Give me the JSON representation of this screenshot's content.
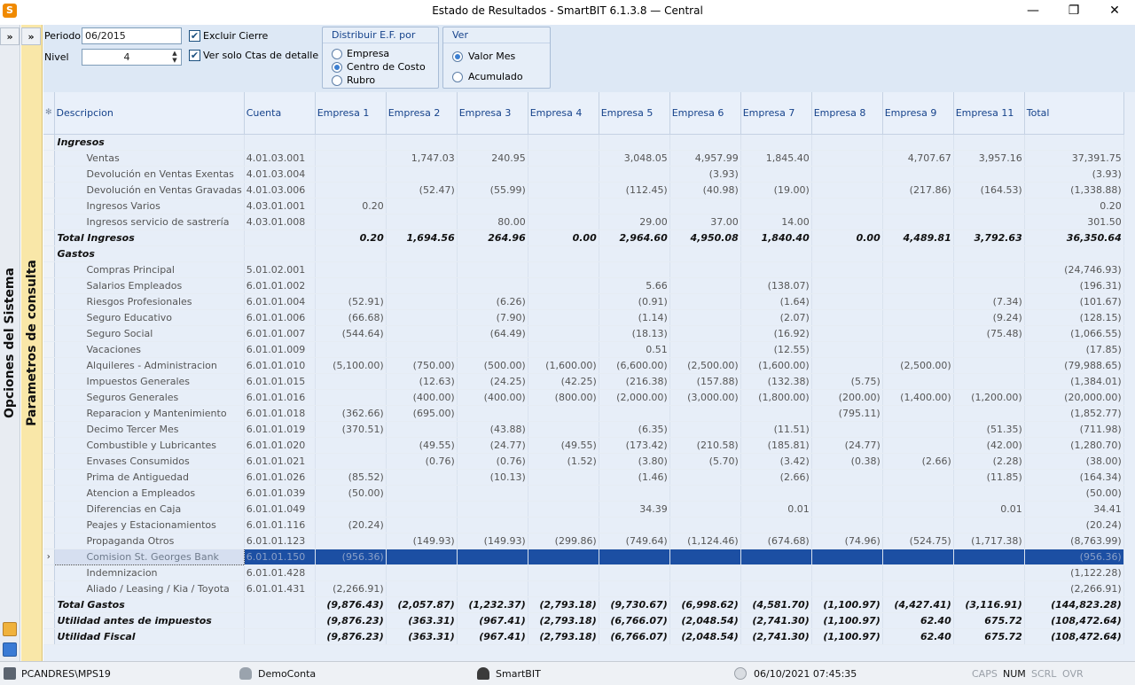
{
  "window": {
    "app_icon": "S",
    "title": "Estado de Resultados - SmartBIT 6.1.3.8 — Central",
    "minimize": "—",
    "restore": "❐",
    "close": "✕"
  },
  "sidebar": {
    "expand_outer": "»",
    "expand_inner": "»",
    "outer_label": "Opciones del Sistema",
    "inner_label": "Parametros de consulta"
  },
  "params": {
    "periodo_label": "Periodo",
    "periodo_value": "06/2015",
    "nivel_label": "Nivel",
    "nivel_value": "4",
    "excluir_cierre_label": "Excluir Cierre",
    "excluir_cierre_checked": "✔",
    "ver_solo_label": "Ver solo Ctas de detalle",
    "ver_solo_checked": "✔",
    "distribuir": {
      "title": "Distribuir E.F. por",
      "options": [
        "Empresa",
        "Centro de Costo",
        "Rubro"
      ]
    },
    "ver": {
      "title": "Ver",
      "options": [
        "Valor Mes",
        "Acumulado"
      ]
    }
  },
  "grid": {
    "indicator_header": "✻",
    "columns": [
      "Descripcion",
      "Cuenta",
      "Empresa 1",
      "Empresa 2",
      "Empresa 3",
      "Empresa 4",
      "Empresa 5",
      "Empresa 6",
      "Empresa 7",
      "Empresa 8",
      "Empresa 9",
      "Empresa 11",
      "Total"
    ],
    "selected_marker": "›",
    "rows": [
      {
        "type": "section",
        "cells": [
          "Ingresos",
          "",
          "",
          "",
          "",
          "",
          "",
          "",
          "",
          "",
          "",
          "",
          ""
        ]
      },
      {
        "type": "detail",
        "cells": [
          "Ventas",
          "4.01.03.001",
          "",
          "1,747.03",
          "240.95",
          "",
          "3,048.05",
          "4,957.99",
          "1,845.40",
          "",
          "4,707.67",
          "3,957.16",
          "37,391.75"
        ]
      },
      {
        "type": "detail",
        "cells": [
          "Devolución en Ventas Exentas",
          "4.01.03.004",
          "",
          "",
          "",
          "",
          "",
          "(3.93)",
          "",
          "",
          "",
          "",
          "(3.93)"
        ]
      },
      {
        "type": "detail",
        "cells": [
          "Devolución en  Ventas Gravadas",
          "4.01.03.006",
          "",
          "(52.47)",
          "(55.99)",
          "",
          "(112.45)",
          "(40.98)",
          "(19.00)",
          "",
          "(217.86)",
          "(164.53)",
          "(1,338.88)"
        ]
      },
      {
        "type": "detail",
        "cells": [
          "Ingresos Varios",
          "4.03.01.001",
          "0.20",
          "",
          "",
          "",
          "",
          "",
          "",
          "",
          "",
          "",
          "0.20"
        ]
      },
      {
        "type": "detail",
        "cells": [
          "Ingresos servicio de sastrería",
          "4.03.01.008",
          "",
          "",
          "80.00",
          "",
          "29.00",
          "37.00",
          "14.00",
          "",
          "",
          "",
          "301.50"
        ]
      },
      {
        "type": "total",
        "cells": [
          "Total Ingresos",
          "",
          "0.20",
          "1,694.56",
          "264.96",
          "0.00",
          "2,964.60",
          "4,950.08",
          "1,840.40",
          "0.00",
          "4,489.81",
          "3,792.63",
          "36,350.64"
        ]
      },
      {
        "type": "section",
        "cells": [
          "Gastos",
          "",
          "",
          "",
          "",
          "",
          "",
          "",
          "",
          "",
          "",
          "",
          ""
        ]
      },
      {
        "type": "detail",
        "cells": [
          "Compras Principal",
          "5.01.02.001",
          "",
          "",
          "",
          "",
          "",
          "",
          "",
          "",
          "",
          "",
          "(24,746.93)"
        ]
      },
      {
        "type": "detail",
        "cells": [
          "Salarios Empleados",
          "6.01.01.002",
          "",
          "",
          "",
          "",
          "5.66",
          "",
          "(138.07)",
          "",
          "",
          "",
          "(196.31)"
        ]
      },
      {
        "type": "detail",
        "cells": [
          "Riesgos Profesionales",
          "6.01.01.004",
          "(52.91)",
          "",
          "(6.26)",
          "",
          "(0.91)",
          "",
          "(1.64)",
          "",
          "",
          "(7.34)",
          "(101.67)"
        ]
      },
      {
        "type": "detail",
        "cells": [
          "Seguro Educativo",
          "6.01.01.006",
          "(66.68)",
          "",
          "(7.90)",
          "",
          "(1.14)",
          "",
          "(2.07)",
          "",
          "",
          "(9.24)",
          "(128.15)"
        ]
      },
      {
        "type": "detail",
        "cells": [
          "Seguro Social",
          "6.01.01.007",
          "(544.64)",
          "",
          "(64.49)",
          "",
          "(18.13)",
          "",
          "(16.92)",
          "",
          "",
          "(75.48)",
          "(1,066.55)"
        ]
      },
      {
        "type": "detail",
        "cells": [
          "Vacaciones",
          "6.01.01.009",
          "",
          "",
          "",
          "",
          "0.51",
          "",
          "(12.55)",
          "",
          "",
          "",
          "(17.85)"
        ]
      },
      {
        "type": "detail",
        "cells": [
          "Alquileres - Administracion",
          "6.01.01.010",
          "(5,100.00)",
          "(750.00)",
          "(500.00)",
          "(1,600.00)",
          "(6,600.00)",
          "(2,500.00)",
          "(1,600.00)",
          "",
          "(2,500.00)",
          "",
          "(79,988.65)"
        ]
      },
      {
        "type": "detail",
        "cells": [
          "Impuestos Generales",
          "6.01.01.015",
          "",
          "(12.63)",
          "(24.25)",
          "(42.25)",
          "(216.38)",
          "(157.88)",
          "(132.38)",
          "(5.75)",
          "",
          "",
          "(1,384.01)"
        ]
      },
      {
        "type": "detail",
        "cells": [
          "Seguros Generales",
          "6.01.01.016",
          "",
          "(400.00)",
          "(400.00)",
          "(800.00)",
          "(2,000.00)",
          "(3,000.00)",
          "(1,800.00)",
          "(200.00)",
          "(1,400.00)",
          "(1,200.00)",
          "(20,000.00)"
        ]
      },
      {
        "type": "detail",
        "cells": [
          "Reparacion y Mantenimiento",
          "6.01.01.018",
          "(362.66)",
          "(695.00)",
          "",
          "",
          "",
          "",
          "",
          "(795.11)",
          "",
          "",
          "(1,852.77)"
        ]
      },
      {
        "type": "detail",
        "cells": [
          "Decimo Tercer Mes",
          "6.01.01.019",
          "(370.51)",
          "",
          "(43.88)",
          "",
          "(6.35)",
          "",
          "(11.51)",
          "",
          "",
          "(51.35)",
          "(711.98)"
        ]
      },
      {
        "type": "detail",
        "cells": [
          "Combustible y Lubricantes",
          "6.01.01.020",
          "",
          "(49.55)",
          "(24.77)",
          "(49.55)",
          "(173.42)",
          "(210.58)",
          "(185.81)",
          "(24.77)",
          "",
          "(42.00)",
          "(1,280.70)"
        ]
      },
      {
        "type": "detail",
        "cells": [
          "Envases Consumidos",
          "6.01.01.021",
          "",
          "(0.76)",
          "(0.76)",
          "(1.52)",
          "(3.80)",
          "(5.70)",
          "(3.42)",
          "(0.38)",
          "(2.66)",
          "(2.28)",
          "(38.00)"
        ]
      },
      {
        "type": "detail",
        "cells": [
          "Prima de Antiguedad",
          "6.01.01.026",
          "(85.52)",
          "",
          "(10.13)",
          "",
          "(1.46)",
          "",
          "(2.66)",
          "",
          "",
          "(11.85)",
          "(164.34)"
        ]
      },
      {
        "type": "detail",
        "cells": [
          "Atencion a Empleados",
          "6.01.01.039",
          "(50.00)",
          "",
          "",
          "",
          "",
          "",
          "",
          "",
          "",
          "",
          "(50.00)"
        ]
      },
      {
        "type": "detail",
        "cells": [
          "Diferencias en Caja",
          "6.01.01.049",
          "",
          "",
          "",
          "",
          "34.39",
          "",
          "0.01",
          "",
          "",
          "0.01",
          "34.41"
        ]
      },
      {
        "type": "detail",
        "cells": [
          "Peajes y Estacionamientos",
          "6.01.01.116",
          "(20.24)",
          "",
          "",
          "",
          "",
          "",
          "",
          "",
          "",
          "",
          "(20.24)"
        ]
      },
      {
        "type": "detail",
        "cells": [
          "Propaganda Otros",
          "6.01.01.123",
          "",
          "(149.93)",
          "(149.93)",
          "(299.86)",
          "(749.64)",
          "(1,124.46)",
          "(674.68)",
          "(74.96)",
          "(524.75)",
          "(1,717.38)",
          "(8,763.99)"
        ]
      },
      {
        "type": "selected",
        "cells": [
          "Comision St. Georges Bank",
          "6.01.01.150",
          "(956.36)",
          "",
          "",
          "",
          "",
          "",
          "",
          "",
          "",
          "",
          "(956.36)"
        ]
      },
      {
        "type": "detail",
        "cells": [
          "Indemnizacion",
          "6.01.01.428",
          "",
          "",
          "",
          "",
          "",
          "",
          "",
          "",
          "",
          "",
          "(1,122.28)"
        ]
      },
      {
        "type": "detail",
        "cells": [
          "Aliado / Leasing / Kia / Toyota",
          "6.01.01.431",
          "(2,266.91)",
          "",
          "",
          "",
          "",
          "",
          "",
          "",
          "",
          "",
          "(2,266.91)"
        ]
      },
      {
        "type": "total",
        "cells": [
          "Total Gastos",
          "",
          "(9,876.43)",
          "(2,057.87)",
          "(1,232.37)",
          "(2,793.18)",
          "(9,730.67)",
          "(6,998.62)",
          "(4,581.70)",
          "(1,100.97)",
          "(4,427.41)",
          "(3,116.91)",
          "(144,823.28)"
        ]
      },
      {
        "type": "total",
        "cells": [
          "Utilidad antes de impuestos",
          "",
          "(9,876.23)",
          "(363.31)",
          "(967.41)",
          "(2,793.18)",
          "(6,766.07)",
          "(2,048.54)",
          "(2,741.30)",
          "(1,100.97)",
          "62.40",
          "675.72",
          "(108,472.64)"
        ]
      },
      {
        "type": "total",
        "cells": [
          "Utilidad Fiscal",
          "",
          "(9,876.23)",
          "(363.31)",
          "(967.41)",
          "(2,793.18)",
          "(6,766.07)",
          "(2,048.54)",
          "(2,741.30)",
          "(1,100.97)",
          "62.40",
          "675.72",
          "(108,472.64)"
        ]
      }
    ]
  },
  "statusbar": {
    "computer": "PCANDRES\\MPS19",
    "database": "DemoConta",
    "user": "SmartBIT",
    "datetime": "06/10/2021 07:45:35",
    "keys": [
      "CAPS",
      "NUM",
      "SCRL",
      "OVR"
    ],
    "icons": [
      "computer-icon",
      "database-icon",
      "user-icon",
      "clock-icon"
    ]
  }
}
